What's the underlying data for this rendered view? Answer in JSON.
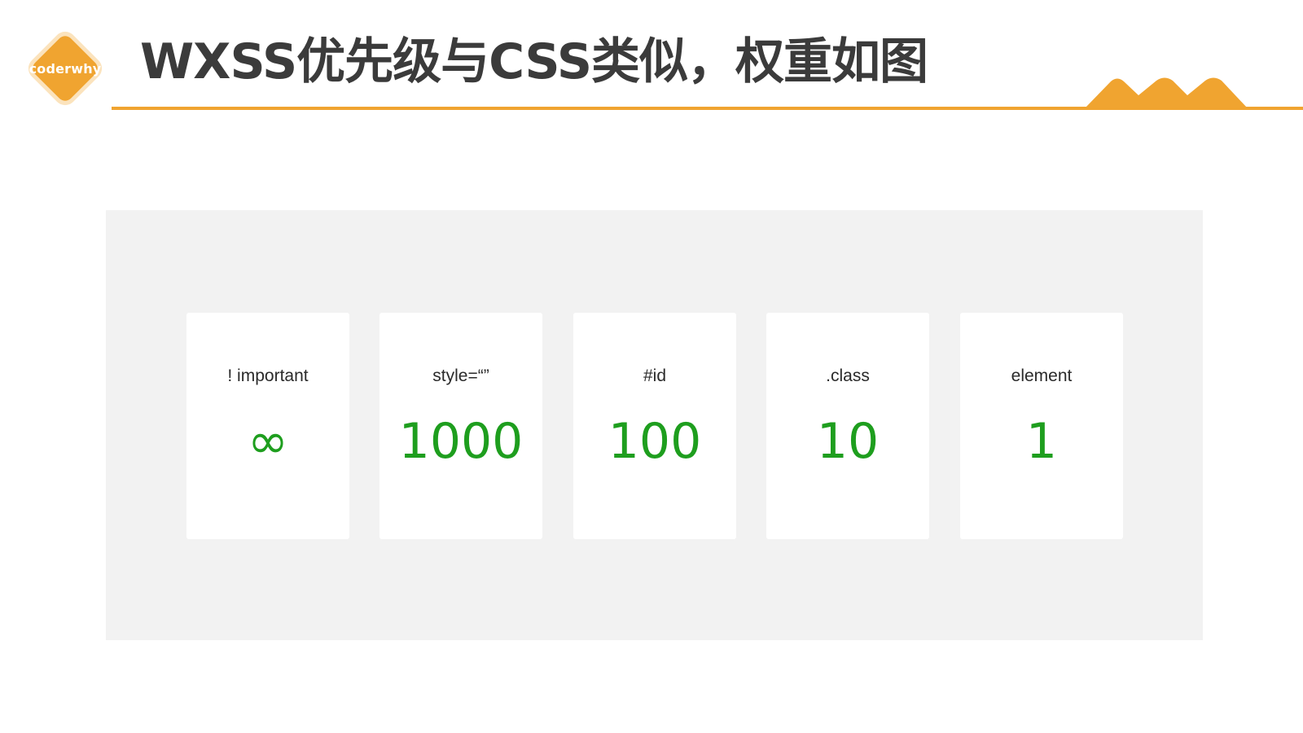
{
  "header": {
    "logo_text": "coderwhy",
    "title": "WXSS优先级与CSS类似，权重如图"
  },
  "colors": {
    "accent": "#f0a430",
    "title": "#3b3b3b",
    "value_green": "#1e9e1e",
    "panel_bg": "#f2f2f2"
  },
  "cards": [
    {
      "label": "! important",
      "value": "∞"
    },
    {
      "label": "style=“”",
      "value": "1000"
    },
    {
      "label": "#id",
      "value": "100"
    },
    {
      "label": ".class",
      "value": "10"
    },
    {
      "label": "element",
      "value": "1"
    }
  ]
}
